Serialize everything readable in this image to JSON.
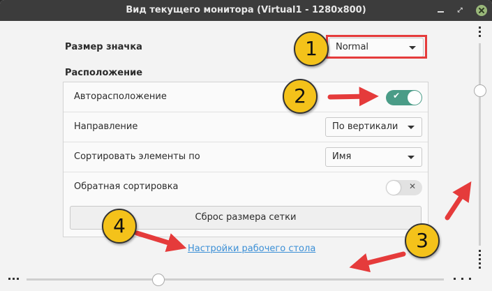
{
  "window": {
    "title": "Вид текущего монитора (Virtual1 - 1280x800)"
  },
  "icon_size": {
    "label": "Размер значка",
    "value": "Normal"
  },
  "layout_section": {
    "title": "Расположение",
    "auto_arrange": {
      "label": "Авторасположение",
      "on": true
    },
    "direction": {
      "label": "Направление",
      "value": "По вертикали"
    },
    "sort_by": {
      "label": "Сортировать элементы по",
      "value": "Имя"
    },
    "reverse_sort": {
      "label": "Обратная сортировка",
      "on": false
    },
    "reset_button": "Сброс размера сетки"
  },
  "desktop_settings_link": "Настройки рабочего стола",
  "annotations": [
    "1",
    "2",
    "3",
    "4"
  ],
  "colors": {
    "badge": "#f4c21a",
    "arrow": "#e53b3b",
    "switch_on": "#4a9c87",
    "link": "#3b8fd6"
  }
}
